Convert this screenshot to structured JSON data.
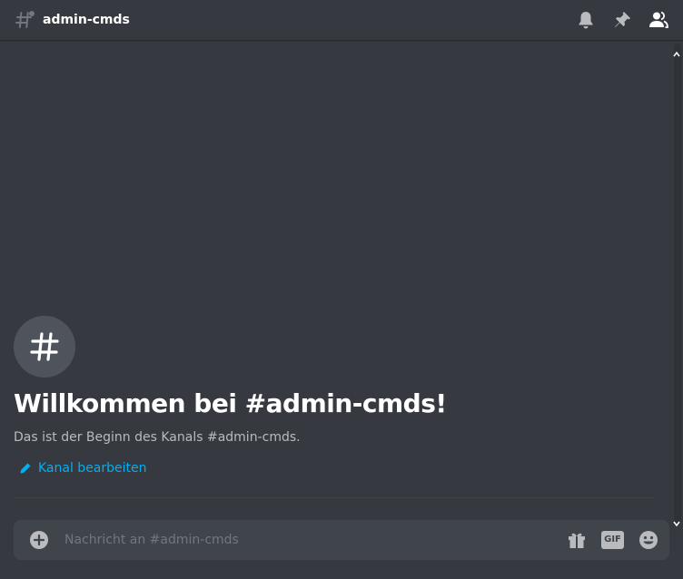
{
  "header": {
    "channel_name": "admin-cmds",
    "icons": [
      "hashtag-threads-icon",
      "bell-icon",
      "pin-icon",
      "members-icon"
    ]
  },
  "welcome": {
    "title": "Willkommen bei #admin-cmds!",
    "description": "Das ist der Beginn des Kanals #admin-cmds.",
    "edit_label": "Kanal bearbeiten"
  },
  "composer": {
    "placeholder": "Nachricht an #admin-cmds",
    "gif_label": "GIF",
    "icons": [
      "plus-circle-icon",
      "gift-icon",
      "gif-icon",
      "emoji-icon"
    ]
  },
  "colors": {
    "background": "#36393f",
    "text": "#ffffff",
    "muted": "#b9bbbe",
    "link": "#00b0f4",
    "input_bg": "#40444b"
  }
}
